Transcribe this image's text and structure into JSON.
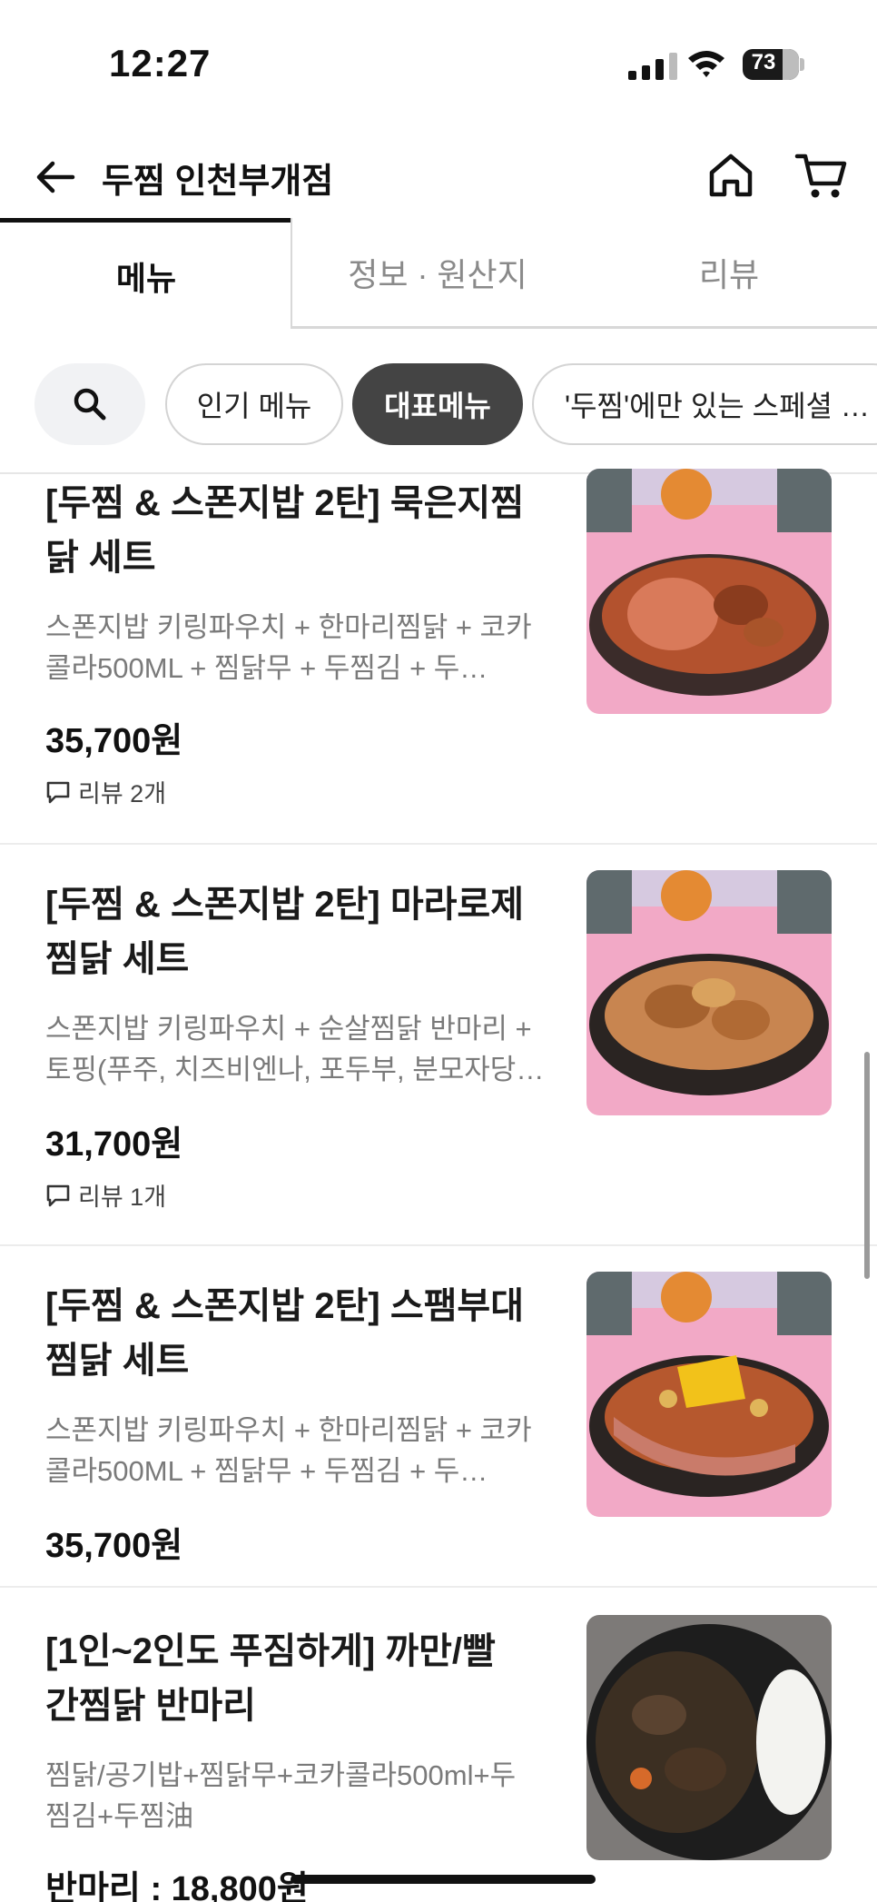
{
  "status_bar": {
    "time": "12:27",
    "battery": "73"
  },
  "header": {
    "title": "두찜 인천부개점"
  },
  "tabs": [
    {
      "label": "메뉴",
      "active": true
    },
    {
      "label": "정보 · 원산지",
      "active": false
    },
    {
      "label": "리뷰",
      "active": false
    }
  ],
  "chips": [
    {
      "label": "인기 메뉴",
      "selected": false
    },
    {
      "label": "대표메뉴",
      "selected": true
    },
    {
      "label": "'두찜'에만 있는 스페셜 …",
      "selected": false
    }
  ],
  "menu_items": [
    {
      "name_line1": "[두찜 & 스폰지밥 2탄] 묵은지찜",
      "name_line2": "닭 세트",
      "desc_line1": "스폰지밥 키링파우치 + 한마리찜닭 + 코카",
      "desc_line2": "콜라500ML + 찜닭무 + 두찜김 + 두…",
      "price": "35,700원",
      "review": "리뷰 2개"
    },
    {
      "name_line1": "[두찜 & 스폰지밥 2탄] 마라로제",
      "name_line2": "찜닭 세트",
      "desc_line1": "스폰지밥 키링파우치 + 순살찜닭 반마리 +",
      "desc_line2": "토핑(푸주, 치즈비엔나, 포두부, 분모자당…",
      "price": "31,700원",
      "review": "리뷰 1개"
    },
    {
      "name_line1": "[두찜 & 스폰지밥 2탄] 스팸부대",
      "name_line2": "찜닭 세트",
      "desc_line1": "스폰지밥 키링파우치 + 한마리찜닭 + 코카",
      "desc_line2": "콜라500ML + 찜닭무 + 두찜김 + 두…",
      "price": "35,700원",
      "review": ""
    },
    {
      "name_line1": "[1인~2인도 푸짐하게] 까만/빨",
      "name_line2": "간찜닭 반마리",
      "desc_line1": "찜닭/공기밥+찜닭무+코카콜라500ml+두",
      "desc_line2": "찜김+두찜油",
      "price": "반마리 : 18,800원",
      "review": ""
    }
  ],
  "colors": {
    "accent_dark": "#444444",
    "thumb_pink": "#f2a9c6"
  }
}
